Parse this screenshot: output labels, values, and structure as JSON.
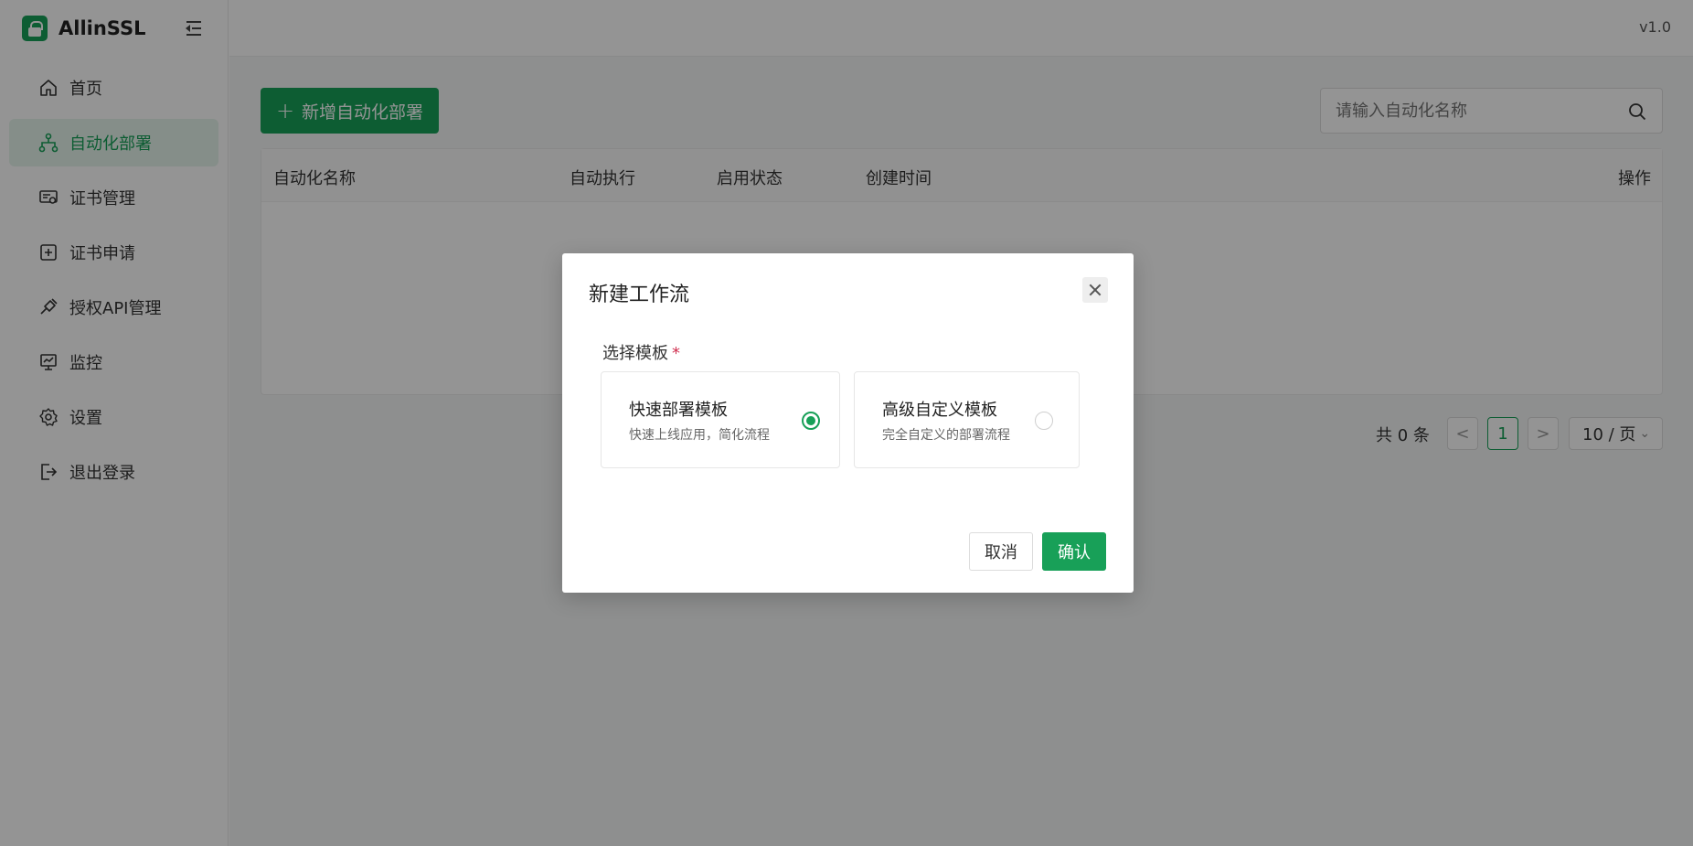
{
  "app": {
    "name": "AllinSSL",
    "version": "v1.0"
  },
  "sidebar": {
    "items": [
      {
        "label": "首页",
        "icon": "home-icon",
        "active": false
      },
      {
        "label": "自动化部署",
        "icon": "workflow-icon",
        "active": true
      },
      {
        "label": "证书管理",
        "icon": "certificate-icon",
        "active": false
      },
      {
        "label": "证书申请",
        "icon": "plus-square-icon",
        "active": false
      },
      {
        "label": "授权API管理",
        "icon": "api-plug-icon",
        "active": false
      },
      {
        "label": "监控",
        "icon": "monitor-icon",
        "active": false
      },
      {
        "label": "设置",
        "icon": "gear-icon",
        "active": false
      },
      {
        "label": "退出登录",
        "icon": "logout-icon",
        "active": false
      }
    ]
  },
  "toolbar": {
    "add_label": "新增自动化部署",
    "search_placeholder": "请输入自动化名称"
  },
  "table": {
    "columns": [
      "自动化名称",
      "自动执行",
      "启用状态",
      "创建时间",
      "操作"
    ],
    "rows": []
  },
  "pagination": {
    "total_label": "共 0 条",
    "current_page": "1",
    "prev": "<",
    "next": ">",
    "page_size": "10 / 页"
  },
  "modal": {
    "title": "新建工作流",
    "field_label": "选择模板",
    "required_mark": "*",
    "options": [
      {
        "title": "快速部署模板",
        "desc": "快速上线应用，简化流程",
        "selected": true
      },
      {
        "title": "高级自定义模板",
        "desc": "完全自定义的部署流程",
        "selected": false
      }
    ],
    "cancel_label": "取消",
    "confirm_label": "确认"
  },
  "colors": {
    "primary": "#18a058",
    "overlay": "rgba(0,0,0,0.42)"
  }
}
